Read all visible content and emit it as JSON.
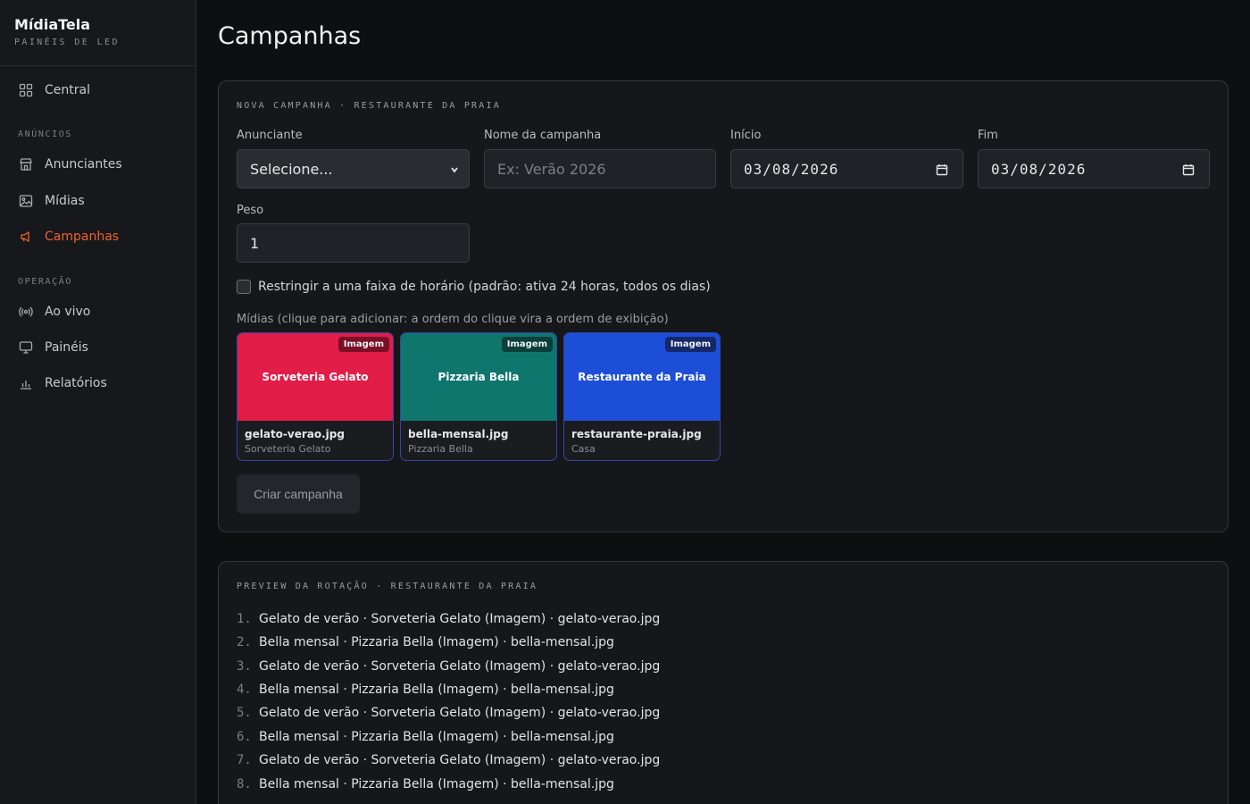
{
  "brand": {
    "name": "MídiaTela",
    "subtitle": "PAINÉIS DE LED"
  },
  "sidebar": {
    "central": {
      "label": "Central",
      "icon": "grid-icon"
    },
    "section_anuncios": "ANÚNCIOS",
    "anunciantes": {
      "label": "Anunciantes",
      "icon": "store-icon"
    },
    "midias": {
      "label": "Mídias",
      "icon": "image-icon"
    },
    "campanhas": {
      "label": "Campanhas",
      "icon": "megaphone-icon",
      "active": true
    },
    "section_operacao": "OPERAÇÃO",
    "ao_vivo": {
      "label": "Ao vivo",
      "icon": "broadcast-icon"
    },
    "paineis": {
      "label": "Painéis",
      "icon": "monitor-icon"
    },
    "relatorios": {
      "label": "Relatórios",
      "icon": "bar-chart-icon"
    }
  },
  "page": {
    "title": "Campanhas"
  },
  "form": {
    "heading": "NOVA CAMPANHA · RESTAURANTE DA PRAIA",
    "anunciante": {
      "label": "Anunciante",
      "value": "Selecione..."
    },
    "nome": {
      "label": "Nome da campanha",
      "placeholder": "Ex: Verão 2026"
    },
    "inicio": {
      "label": "Início",
      "value": "03/08/2026"
    },
    "fim": {
      "label": "Fim",
      "value": "03/08/2026"
    },
    "peso": {
      "label": "Peso",
      "value": "1"
    },
    "restrict_label": "Restringir a uma faixa de horário (padrão: ativa 24 horas, todos os dias)",
    "media_label": "Mídias (clique para adicionar: a ordem do clique vira a ordem de exibição)",
    "media": [
      {
        "title": "Sorveteria Gelato",
        "badge": "Imagem",
        "file": "gelato-verao.jpg",
        "owner": "Sorveteria Gelato",
        "color": "#e11d48",
        "badge_color": "#7a1027"
      },
      {
        "title": "Pizzaria Bella",
        "badge": "Imagem",
        "file": "bella-mensal.jpg",
        "owner": "Pizzaria Bella",
        "color": "#0f766e",
        "badge_color": "#0b3f3b"
      },
      {
        "title": "Restaurante da Praia",
        "badge": "Imagem",
        "file": "restaurante-praia.jpg",
        "owner": "Casa",
        "color": "#1d4ed8",
        "badge_color": "#14286a"
      }
    ],
    "submit_label": "Criar campanha"
  },
  "rotation": {
    "heading": "PREVIEW DA ROTAÇÃO · RESTAURANTE DA PRAIA",
    "items": [
      {
        "num": "1.",
        "text": "Gelato de verão · Sorveteria Gelato (Imagem) · gelato-verao.jpg"
      },
      {
        "num": "2.",
        "text": "Bella mensal · Pizzaria Bella (Imagem) · bella-mensal.jpg"
      },
      {
        "num": "3.",
        "text": "Gelato de verão · Sorveteria Gelato (Imagem) · gelato-verao.jpg"
      },
      {
        "num": "4.",
        "text": "Bella mensal · Pizzaria Bella (Imagem) · bella-mensal.jpg"
      },
      {
        "num": "5.",
        "text": "Gelato de verão · Sorveteria Gelato (Imagem) · gelato-verao.jpg"
      },
      {
        "num": "6.",
        "text": "Bella mensal · Pizzaria Bella (Imagem) · bella-mensal.jpg"
      },
      {
        "num": "7.",
        "text": "Gelato de verão · Sorveteria Gelato (Imagem) · gelato-verao.jpg"
      },
      {
        "num": "8.",
        "text": "Bella mensal · Pizzaria Bella (Imagem) · bella-mensal.jpg"
      }
    ]
  },
  "colors": {
    "accent": "#f0612b",
    "background": "#0e0f11",
    "card": "#15171a"
  }
}
